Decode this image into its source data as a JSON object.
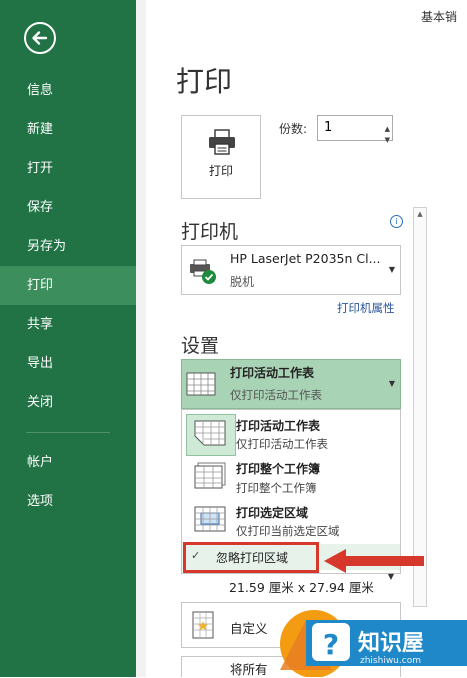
{
  "window": {
    "topbar_text": "基本销"
  },
  "sidebar": {
    "items": [
      {
        "label": "信息"
      },
      {
        "label": "新建"
      },
      {
        "label": "打开"
      },
      {
        "label": "保存"
      },
      {
        "label": "另存为"
      },
      {
        "label": "打印"
      },
      {
        "label": "共享"
      },
      {
        "label": "导出"
      },
      {
        "label": "关闭"
      },
      {
        "label": "帐户"
      },
      {
        "label": "选项"
      }
    ],
    "active": "打印"
  },
  "page": {
    "title": "打印"
  },
  "print": {
    "button_label": "打印",
    "copies_label": "份数:",
    "copies_value": "1"
  },
  "printer": {
    "section_title": "打印机",
    "name": "HP LaserJet P2035n Cl...",
    "status": "脱机",
    "properties_link": "打印机属性"
  },
  "settings": {
    "section_title": "设置",
    "selected": {
      "title": "打印活动工作表",
      "desc": "仅打印活动工作表"
    },
    "options": [
      {
        "title": "打印活动工作表",
        "desc": "仅打印活动工作表"
      },
      {
        "title": "打印整个工作簿",
        "desc": "打印整个工作簿"
      },
      {
        "title": "打印选定区域",
        "desc": "仅打印当前选定区域"
      }
    ],
    "ignore_print_area": "忽略打印区域",
    "paper_size": "21.59 厘米 x 27.94 厘米",
    "custom_label": "自定义",
    "last_label": "将所有"
  },
  "watermark": {
    "brand": "知识屋",
    "url": "zhishiwu.com"
  },
  "colors": {
    "sidebar": "#217346",
    "sidebar_active": "#3c8f5c",
    "highlight": "#a9d3b5",
    "annotation": "#d7382c"
  }
}
